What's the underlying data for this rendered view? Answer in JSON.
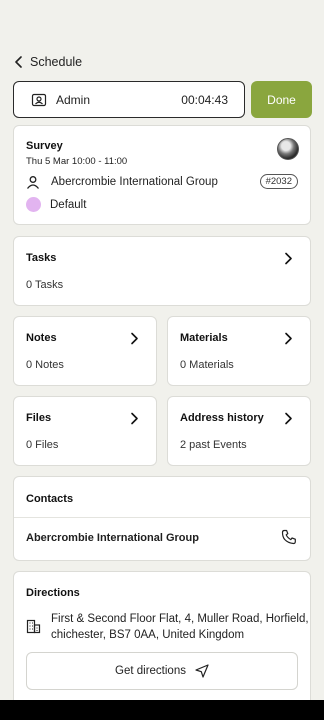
{
  "nav": {
    "back_label": "Schedule"
  },
  "timer": {
    "user": "Admin",
    "elapsed": "00:04:43",
    "done_label": "Done"
  },
  "job": {
    "title": "Survey",
    "datetime": "Thu 5 Mar 10:00 - 11:00",
    "customer": "Abercrombie International Group",
    "number": "#2032",
    "tag": "Default",
    "tag_color": "#e2b4f0"
  },
  "sections": {
    "tasks": {
      "title": "Tasks",
      "summary": "0 Tasks"
    },
    "notes": {
      "title": "Notes",
      "summary": "0 Notes"
    },
    "materials": {
      "title": "Materials",
      "summary": "0 Materials"
    },
    "files": {
      "title": "Files",
      "summary": "0 Files"
    },
    "address_history": {
      "title": "Address history",
      "summary": "2 past Events"
    }
  },
  "contacts": {
    "title": "Contacts",
    "items": [
      {
        "name": "Abercrombie International Group"
      }
    ]
  },
  "directions": {
    "title": "Directions",
    "address": "First & Second Floor Flat, 4, Muller Road, Horfield, chichester, BS7 0AA, United Kingdom",
    "button_label": "Get directions"
  },
  "colors": {
    "accent": "#8aa63e",
    "background": "#f1f1ec"
  },
  "icons": {
    "back": "chevron-left-icon",
    "user": "id-badge-icon",
    "customer": "person-icon",
    "chevron": "chevron-right-icon",
    "phone": "phone-icon",
    "building": "building-icon",
    "navigate": "navigation-arrow-icon"
  }
}
